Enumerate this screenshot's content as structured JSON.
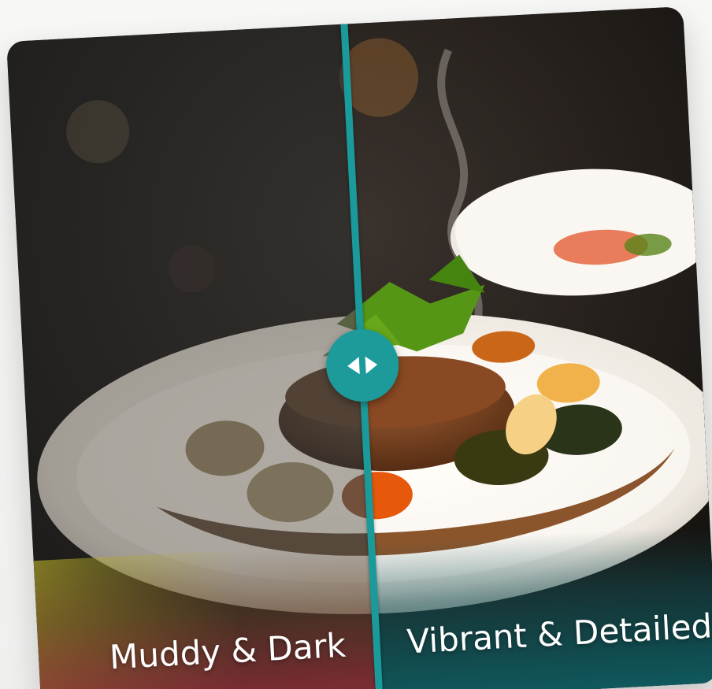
{
  "comparison": {
    "before_label": "Muddy & Dark",
    "after_label": "Vibrant & Detailed",
    "split_position": 0.5,
    "accent_color": "#1d9b9b",
    "before_tint": "#96323c",
    "after_tint": "#0f5f64"
  },
  "handle": {
    "icon_left": "chevron-left-icon",
    "icon_right": "chevron-right-icon"
  }
}
